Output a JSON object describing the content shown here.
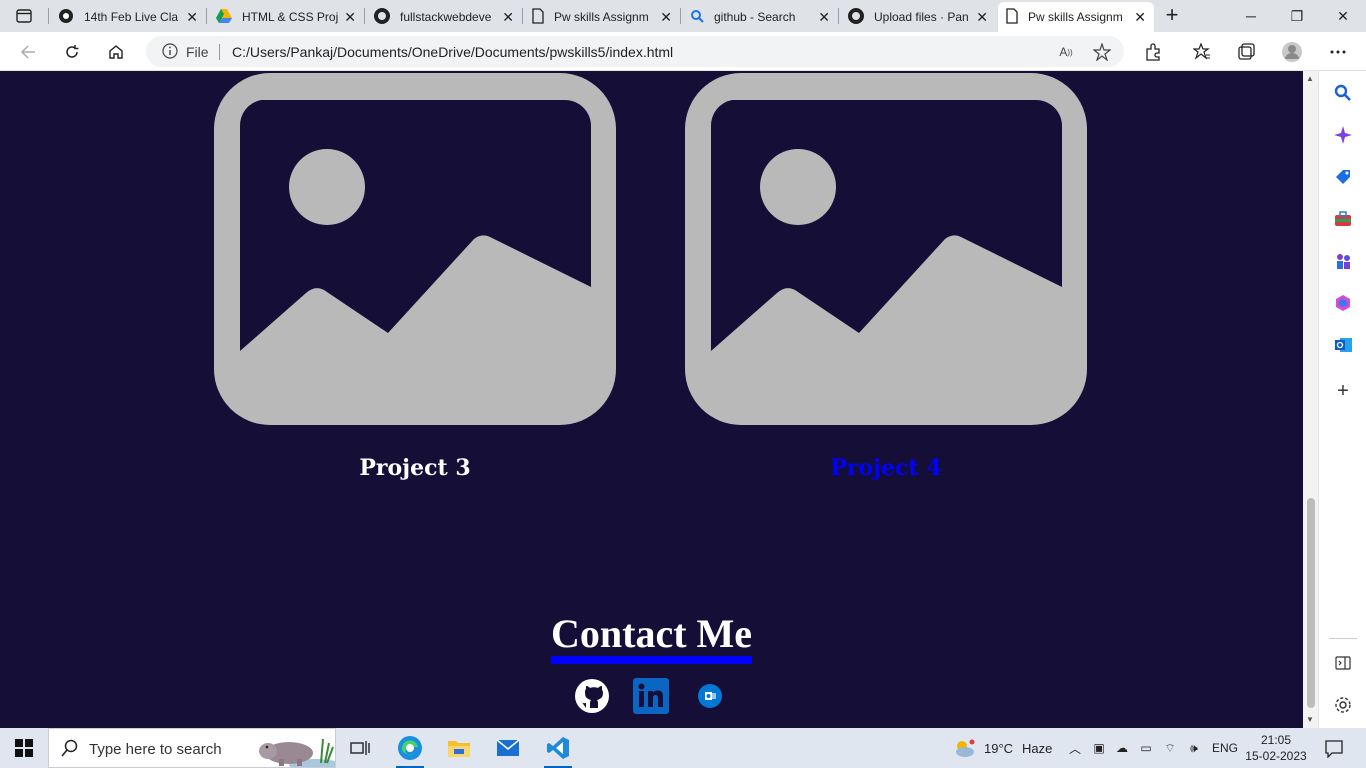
{
  "browser": {
    "tabs": [
      {
        "title": "14th Feb Live Cla",
        "icon": "webpage-icon"
      },
      {
        "title": "HTML & CSS Proj",
        "icon": "google-drive-icon"
      },
      {
        "title": "fullstackwebdeve",
        "icon": "github-icon"
      },
      {
        "title": "Pw skills Assignm",
        "icon": "document-icon"
      },
      {
        "title": "github - Search",
        "icon": "search-icon"
      },
      {
        "title": "Upload files · Pan",
        "icon": "github-icon"
      },
      {
        "title": "Pw skills Assignm",
        "icon": "document-icon",
        "active": true
      }
    ],
    "address": {
      "scheme_label": "File",
      "url": "C:/Users/Pankaj/Documents/OneDrive/Documents/pwskills5/index.html"
    }
  },
  "page": {
    "projects": [
      {
        "title": "Project 3",
        "title_color": "#ffffff"
      },
      {
        "title": "Project 4",
        "title_color": "#0000ff"
      }
    ],
    "contact": {
      "heading": "Contact Me"
    },
    "social": [
      "github-icon",
      "linkedin-icon",
      "outlook-icon"
    ],
    "colors": {
      "background": "#150f37",
      "placeholder": "#b9b9b9",
      "underline": "#0000ff"
    }
  },
  "taskbar": {
    "search_placeholder": "Type here to search",
    "weather": {
      "temp": "19°C",
      "condition": "Haze"
    },
    "language": "ENG",
    "time": "21:05",
    "date": "15-02-2023"
  }
}
